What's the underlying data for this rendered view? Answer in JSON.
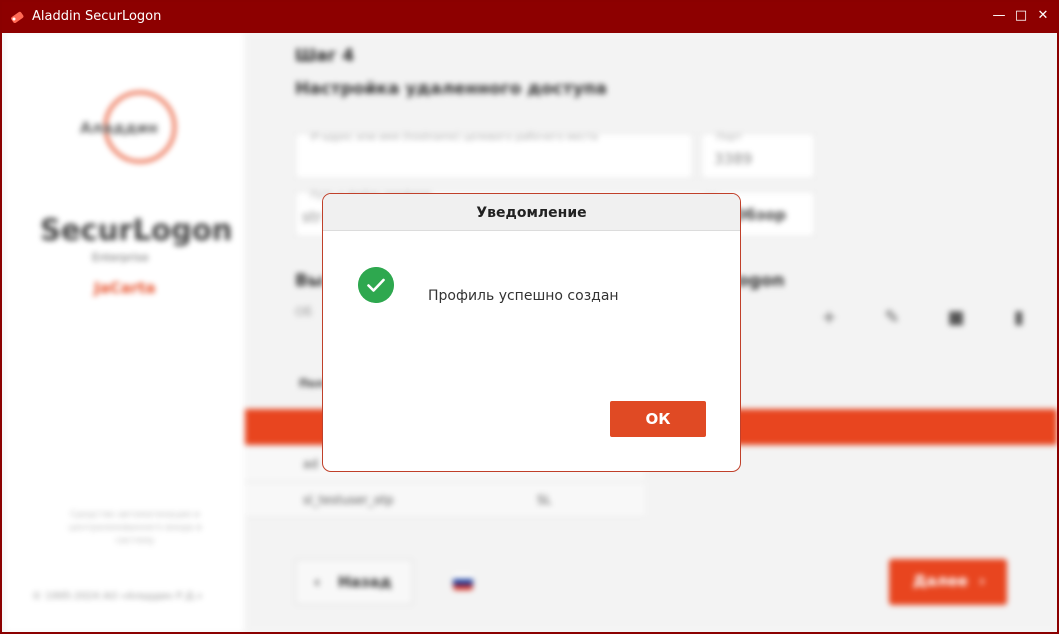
{
  "window": {
    "title": "Aladdin SecurLogon",
    "controls": [
      "minimize-icon",
      "maximize-icon",
      "close-icon"
    ]
  },
  "sidebar": {
    "logo_text": "Аладдин",
    "brand": "SecurLogon",
    "edition": "Enterprise",
    "brand_link": "JaCarta",
    "note": "Средство автоматизации и централизованного входа в систему",
    "copyright": "© 1995-2024 АО «Аладдин Р.Д.»"
  },
  "main": {
    "step": "Шаг 4",
    "section_title": "Настройка удаленного доступа",
    "host_field": {
      "label": "IP-адрес или имя (hostname) целевого рабочего места",
      "value": ""
    },
    "port_field": {
      "label": "Порт",
      "value": "3389"
    },
    "path_field": {
      "label": "Путь к файлу профиля",
      "value": "str"
    },
    "browse_label": "Обзор",
    "section2_title": "Вы",
    "section2_title_right": "ogon",
    "section2_sub": "Об",
    "table": {
      "header": "Пол",
      "rows": [
        {
          "name": "ad",
          "type": ""
        },
        {
          "name": "sl_testuser_otp",
          "type": "SL"
        }
      ]
    },
    "toolbar_icons": [
      "add-icon",
      "edit-icon",
      "delete-icon",
      "token-icon"
    ],
    "back_label": "Назад",
    "next_label": "Далее",
    "language": "ru"
  },
  "dialog": {
    "title": "Уведомление",
    "message": "Профиль успешно создан",
    "ok_label": "ОК",
    "icon": "success-check-icon"
  },
  "colors": {
    "titlebar": "#8d0000",
    "accent": "#e8451f",
    "success": "#2ea84f"
  }
}
